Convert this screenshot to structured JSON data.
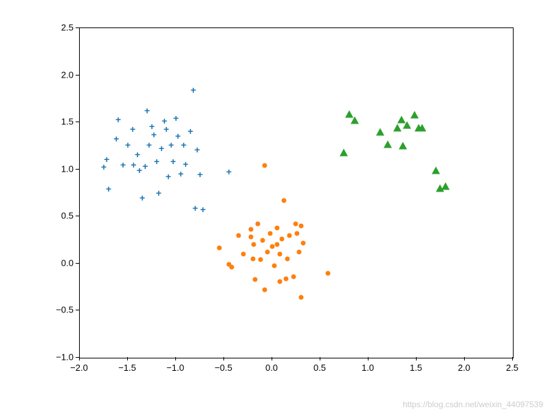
{
  "chart_data": {
    "type": "scatter",
    "title": "",
    "xlabel": "",
    "ylabel": "",
    "xlim": [
      -2.0,
      2.5
    ],
    "ylim": [
      -1.0,
      2.5
    ],
    "xticks": [
      -2.0,
      -1.5,
      -1.0,
      -0.5,
      0.0,
      0.5,
      1.0,
      1.5,
      2.0,
      2.5
    ],
    "yticks": [
      -1.0,
      -0.5,
      0.0,
      0.5,
      1.0,
      1.5,
      2.0,
      2.5
    ],
    "xtick_labels": [
      "−2.0",
      "−1.5",
      "−1.0",
      "−0.5",
      "0.0",
      "0.5",
      "1.0",
      "1.5",
      "2.0",
      "2.5"
    ],
    "ytick_labels": [
      "−1.0",
      "−0.5",
      "0.0",
      "0.5",
      "1.0",
      "1.5",
      "2.0",
      "2.5"
    ],
    "series": [
      {
        "name": "cluster-blue-plus",
        "marker": "plus",
        "color": "#1f77b4",
        "points": [
          {
            "x": -1.75,
            "y": 1.02
          },
          {
            "x": -1.72,
            "y": 1.1
          },
          {
            "x": -1.7,
            "y": 0.79
          },
          {
            "x": -1.62,
            "y": 1.32
          },
          {
            "x": -1.6,
            "y": 1.52
          },
          {
            "x": -1.55,
            "y": 1.04
          },
          {
            "x": -1.5,
            "y": 1.25
          },
          {
            "x": -1.45,
            "y": 1.42
          },
          {
            "x": -1.44,
            "y": 1.04
          },
          {
            "x": -1.4,
            "y": 1.15
          },
          {
            "x": -1.38,
            "y": 0.98
          },
          {
            "x": -1.35,
            "y": 0.69
          },
          {
            "x": -1.32,
            "y": 1.03
          },
          {
            "x": -1.3,
            "y": 1.62
          },
          {
            "x": -1.28,
            "y": 1.25
          },
          {
            "x": -1.25,
            "y": 1.45
          },
          {
            "x": -1.23,
            "y": 1.36
          },
          {
            "x": -1.2,
            "y": 1.08
          },
          {
            "x": -1.18,
            "y": 0.74
          },
          {
            "x": -1.15,
            "y": 1.22
          },
          {
            "x": -1.12,
            "y": 1.51
          },
          {
            "x": -1.1,
            "y": 1.42
          },
          {
            "x": -1.08,
            "y": 0.92
          },
          {
            "x": -1.05,
            "y": 1.25
          },
          {
            "x": -1.03,
            "y": 1.08
          },
          {
            "x": -1.0,
            "y": 1.54
          },
          {
            "x": -0.98,
            "y": 1.35
          },
          {
            "x": -0.95,
            "y": 0.95
          },
          {
            "x": -0.92,
            "y": 1.25
          },
          {
            "x": -0.9,
            "y": 1.05
          },
          {
            "x": -0.85,
            "y": 1.4
          },
          {
            "x": -0.82,
            "y": 1.84
          },
          {
            "x": -0.8,
            "y": 0.58
          },
          {
            "x": -0.78,
            "y": 1.2
          },
          {
            "x": -0.75,
            "y": 0.94
          },
          {
            "x": -0.72,
            "y": 0.57
          },
          {
            "x": -0.45,
            "y": 0.97
          }
        ]
      },
      {
        "name": "cluster-orange-dot",
        "marker": "dot",
        "color": "#ff7f0e",
        "points": [
          {
            "x": -0.55,
            "y": 0.17
          },
          {
            "x": -0.45,
            "y": -0.01
          },
          {
            "x": -0.42,
            "y": -0.04
          },
          {
            "x": -0.35,
            "y": 0.3
          },
          {
            "x": -0.3,
            "y": 0.1
          },
          {
            "x": -0.22,
            "y": 0.36
          },
          {
            "x": -0.22,
            "y": 0.28
          },
          {
            "x": -0.2,
            "y": 0.05
          },
          {
            "x": -0.19,
            "y": 0.2
          },
          {
            "x": -0.18,
            "y": -0.17
          },
          {
            "x": -0.15,
            "y": 0.42
          },
          {
            "x": -0.12,
            "y": 0.04
          },
          {
            "x": -0.1,
            "y": 0.25
          },
          {
            "x": -0.08,
            "y": 1.04
          },
          {
            "x": -0.08,
            "y": -0.28
          },
          {
            "x": -0.05,
            "y": 0.12
          },
          {
            "x": -0.02,
            "y": 0.32
          },
          {
            "x": 0.0,
            "y": 0.18
          },
          {
            "x": 0.02,
            "y": -0.02
          },
          {
            "x": 0.05,
            "y": 0.38
          },
          {
            "x": 0.05,
            "y": 0.2
          },
          {
            "x": 0.08,
            "y": -0.19
          },
          {
            "x": 0.08,
            "y": 0.1
          },
          {
            "x": 0.1,
            "y": 0.26
          },
          {
            "x": 0.12,
            "y": 0.67
          },
          {
            "x": 0.14,
            "y": -0.16
          },
          {
            "x": 0.16,
            "y": 0.05
          },
          {
            "x": 0.18,
            "y": 0.3
          },
          {
            "x": 0.22,
            "y": -0.14
          },
          {
            "x": 0.24,
            "y": 0.42
          },
          {
            "x": 0.26,
            "y": 0.32
          },
          {
            "x": 0.28,
            "y": 0.12
          },
          {
            "x": 0.3,
            "y": 0.4
          },
          {
            "x": 0.3,
            "y": -0.36
          },
          {
            "x": 0.32,
            "y": 0.22
          },
          {
            "x": 0.58,
            "y": -0.1
          }
        ]
      },
      {
        "name": "cluster-green-triangle",
        "marker": "triangle",
        "color": "#2ca02c",
        "points": [
          {
            "x": 0.74,
            "y": 1.18
          },
          {
            "x": 0.8,
            "y": 1.59
          },
          {
            "x": 0.86,
            "y": 1.52
          },
          {
            "x": 1.12,
            "y": 1.4
          },
          {
            "x": 1.2,
            "y": 1.27
          },
          {
            "x": 1.3,
            "y": 1.44
          },
          {
            "x": 1.34,
            "y": 1.53
          },
          {
            "x": 1.36,
            "y": 1.25
          },
          {
            "x": 1.4,
            "y": 1.47
          },
          {
            "x": 1.48,
            "y": 1.58
          },
          {
            "x": 1.52,
            "y": 1.44
          },
          {
            "x": 1.56,
            "y": 1.44
          },
          {
            "x": 1.7,
            "y": 0.99
          },
          {
            "x": 1.74,
            "y": 0.8
          },
          {
            "x": 1.8,
            "y": 0.82
          }
        ]
      }
    ]
  },
  "watermark": "https://blog.csdn.net/weixin_44097539"
}
